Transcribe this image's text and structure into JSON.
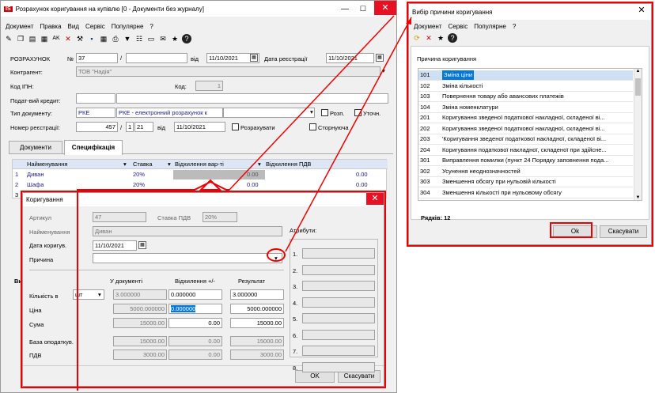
{
  "main": {
    "title": "Розрахунок коригування на купівлю [0 - Документи без журналу]",
    "menu": [
      "Документ",
      "Правка",
      "Вид",
      "Сервіс",
      "Популярне",
      "?"
    ],
    "labels": {
      "doc": "РОЗРАХУНОК",
      "no": "№",
      "from": "від",
      "reg_date": "Дата реєстрації",
      "counterparty": "Контрагент:",
      "ipn": "Код ІПН:",
      "code": "Код:",
      "tax_credit": "Подат-вий кредит:",
      "doc_type": "Тип документу:",
      "reg_no": "Номер реєстрації:",
      "from2": "від"
    },
    "values": {
      "number": "37",
      "slash": "/",
      "date": "11/10/2021",
      "reg_date": "11/10/2021",
      "counterparty": "ТОВ \"Надія\"",
      "code": "1",
      "doc_type_code": "РКЕ",
      "doc_type_name": "РКЕ - електронний розрахунок к",
      "reg_no": "457",
      "reg_slash": "1",
      "reg_no2": "21",
      "reg_from": "11/10/2021"
    },
    "checks": {
      "rozp": "Розп.",
      "utoch": "Уточн.",
      "calc": "Розрахувати",
      "storno": "Сторнуюча"
    },
    "tabs": [
      "Документи",
      "Специфікація"
    ],
    "columns": [
      "Найменування",
      "Ставка",
      "Відхилення вар-ті",
      "Відхилення ПДВ"
    ],
    "rows": [
      {
        "n": "1",
        "name": "Диван",
        "rate": "20%",
        "dev": "0.00",
        "vat": "0.00"
      },
      {
        "n": "2",
        "name": "Шафа",
        "rate": "20%",
        "dev": "0.00",
        "vat": "0.00"
      },
      {
        "n": "3",
        "name": "",
        "rate": "",
        "dev": "",
        "vat": ""
      }
    ],
    "side_label": "Ви"
  },
  "korig": {
    "title": "Коригування",
    "labels": {
      "article": "Артикул",
      "vat_rate": "Ставка ПДВ",
      "name": "Найменування",
      "date": "Дата коригув.",
      "reason": "Причина",
      "attrs": "Атрибути:",
      "in_doc": "У документі",
      "deviation": "Відхилення +/-",
      "result": "Результат",
      "qty": "Кількість в",
      "price": "Ціна",
      "sum": "Сума",
      "base": "База оподаткув.",
      "vat": "ПДВ"
    },
    "values": {
      "article": "47",
      "vat_rate": "20%",
      "name": "Диван",
      "date": "11/10/2021",
      "unit": "шт",
      "qty_doc": "3.000000",
      "qty_dev": "0.000000",
      "qty_res": "3.000000",
      "price_doc": "5000.000000",
      "price_dev": "0.000000",
      "price_res": "5000.000000",
      "sum_doc": "15000.00",
      "sum_dev": "0.00",
      "sum_res": "15000.00",
      "base_doc": "15000.00",
      "base_dev": "0.00",
      "base_res": "15000.00",
      "vat_doc": "3000.00",
      "vat_dev": "0.00",
      "vat_res": "3000.00"
    },
    "attr_nums": [
      "1.",
      "2.",
      "3.",
      "4.",
      "5.",
      "6.",
      "7.",
      "8."
    ],
    "ok": "OK",
    "cancel": "Скасувати"
  },
  "vybir": {
    "title": "Вибір причини коригування",
    "menu": [
      "Документ",
      "Сервіс",
      "Популярне",
      "?"
    ],
    "header": "Причина коригування",
    "rows": [
      {
        "code": "101",
        "text": "Зміна ціни"
      },
      {
        "code": "102",
        "text": "Зміна кількості"
      },
      {
        "code": "103",
        "text": "Повернення товару або авансових платежів"
      },
      {
        "code": "104",
        "text": "Зміна номенклатури"
      },
      {
        "code": "201",
        "text": "Коригування зведеної податкової накладної, складеної ві..."
      },
      {
        "code": "202",
        "text": "Коригування зведеної податкової накладної, складеної ві..."
      },
      {
        "code": "203",
        "text": "'Коригування зведеної податкової накладної, складеної ві..."
      },
      {
        "code": "204",
        "text": "Коригування податкової накладної, складеної при здійсне..."
      },
      {
        "code": "301",
        "text": "Виправлення помилки (пункт 24 Порядку заповнення пода..."
      },
      {
        "code": "302",
        "text": "Усунення неоднозначностей"
      },
      {
        "code": "303",
        "text": "Зменшення обсягу при нульовій кількості"
      },
      {
        "code": "304",
        "text": "Зменшення кількості при нульовому обсягу"
      }
    ],
    "count": "Рядків: 12",
    "ok": "Ok",
    "cancel": "Скасувати"
  },
  "colors": {
    "accent": "#e00000",
    "selection": "#0078d7",
    "grid_header": "#dce6f4"
  }
}
